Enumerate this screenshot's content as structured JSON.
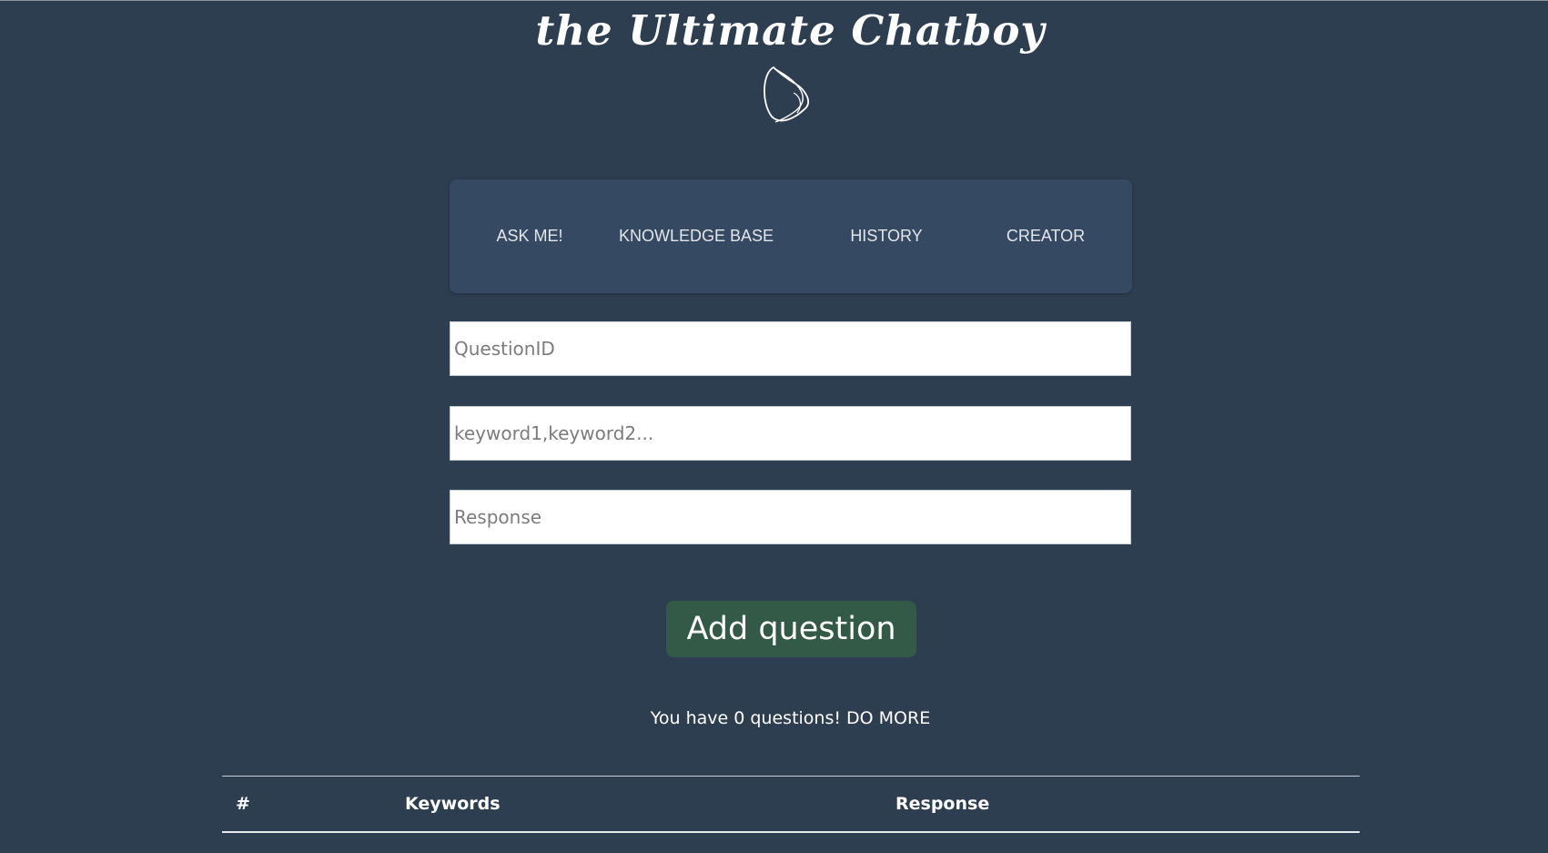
{
  "header": {
    "title": "the Ultimate Chatboy",
    "logo_icon": "bot-swirl-icon"
  },
  "nav": {
    "items": [
      {
        "label": "ASK ME!"
      },
      {
        "label": "KNOWLEDGE BASE"
      },
      {
        "label": "HISTORY"
      },
      {
        "label": "CREATOR"
      }
    ]
  },
  "form": {
    "question_id": {
      "placeholder": "QuestionID",
      "value": ""
    },
    "keywords": {
      "placeholder": "keyword1,keyword2...",
      "value": ""
    },
    "response": {
      "placeholder": "Response",
      "value": ""
    },
    "submit_label": "Add question"
  },
  "status": {
    "message": "You have 0 questions! DO MORE"
  },
  "table": {
    "columns": [
      "#",
      "Keywords",
      "Response"
    ],
    "rows": []
  },
  "colors": {
    "background": "#2e3e51",
    "nav_panel": "#354a62",
    "button": "#325a46",
    "text": "#ffffff"
  }
}
